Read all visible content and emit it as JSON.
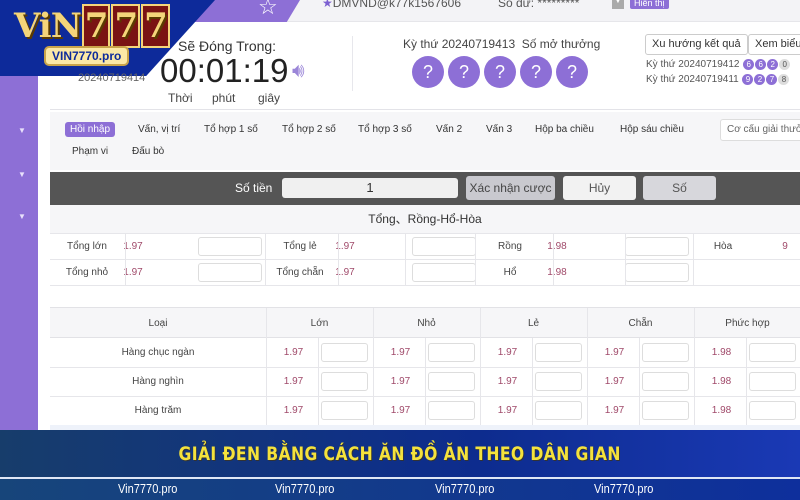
{
  "brand": {
    "logo": "VIN777",
    "domain": "VIN7770.pro"
  },
  "topbar": {
    "account": "DMVND@k77k1567606",
    "balance_label": "Số dư:",
    "balance": "*********",
    "show_btn": "Hiển thị"
  },
  "timer": {
    "label": "Sẽ Đóng Trong:",
    "value": "00:01:19",
    "prev_round": "20240719414",
    "units": [
      "Thời",
      "phút",
      "giây"
    ]
  },
  "draw": {
    "round_label": "Kỳ thứ 20240719413",
    "result_label": "Số mở thưởng",
    "balls": [
      "?",
      "?",
      "?",
      "?",
      "?"
    ]
  },
  "side_buttons": [
    "Xu hướng kết quả",
    "Xem biểu"
  ],
  "history": [
    {
      "label": "Kỳ thứ 20240719412",
      "balls": [
        "6",
        "6",
        "2",
        "0"
      ]
    },
    {
      "label": "Kỳ thứ 20240719411",
      "balls": [
        "9",
        "2",
        "7",
        "8"
      ]
    }
  ],
  "tabs": [
    "Hồi nhập",
    "Vấn, vị trí",
    "Tổ hợp 1 số",
    "Tổ hợp 2 số",
    "Tổ hợp 3 số",
    "Vấn 2",
    "Vấn 3",
    "Hộp ba chiều",
    "Hộp sáu chiều",
    "Phạm vi",
    "Đấu bò"
  ],
  "active_tab": "Hồi nhập",
  "prize_select": "Cơ cấu giải thưởng",
  "betbar": {
    "amount_label": "Số tiền",
    "amount": "1",
    "confirm": "Xác nhận cược",
    "cancel": "Hủy",
    "number": "Số"
  },
  "section1": {
    "title": "Tổng、Rồng-Hổ-Hòa",
    "rows": [
      [
        {
          "k": "Tổng lớn",
          "v": "1.97"
        },
        {
          "k": "Tổng lẻ",
          "v": "1.97"
        },
        {
          "k": "Rồng",
          "v": "1.98"
        },
        {
          "k": "Hòa",
          "v": "9"
        }
      ],
      [
        {
          "k": "Tổng nhỏ",
          "v": "1.97"
        },
        {
          "k": "Tổng chẵn",
          "v": "1.97"
        },
        {
          "k": "Hổ",
          "v": "1.98"
        }
      ]
    ]
  },
  "section2": {
    "headers": [
      "Loại",
      "Lớn",
      "Nhỏ",
      "Lẻ",
      "Chẵn",
      "Phức hợp"
    ],
    "rows": [
      {
        "name": "Hàng chục ngàn",
        "odds": [
          "1.97",
          "1.97",
          "1.97",
          "1.97",
          "1.98"
        ]
      },
      {
        "name": "Hàng nghìn",
        "odds": [
          "1.97",
          "1.97",
          "1.97",
          "1.97",
          "1.98"
        ]
      },
      {
        "name": "Hàng trăm",
        "odds": [
          "1.97",
          "1.97",
          "1.97",
          "1.97",
          "1.98"
        ]
      }
    ]
  },
  "banner": "GIẢI ĐEN BẰNG CÁCH ĂN ĐỒ ĂN THEO DÂN GIAN",
  "footer": [
    "Vin7770.pro",
    "Vin7770.pro",
    "Vin7770.pro",
    "Vin7770.pro"
  ],
  "colors": {
    "accent": "#8d6fd6",
    "banner_bg": "#0d2c8e",
    "banner_text": "#f4e23c",
    "odds": "#a04a6a"
  }
}
